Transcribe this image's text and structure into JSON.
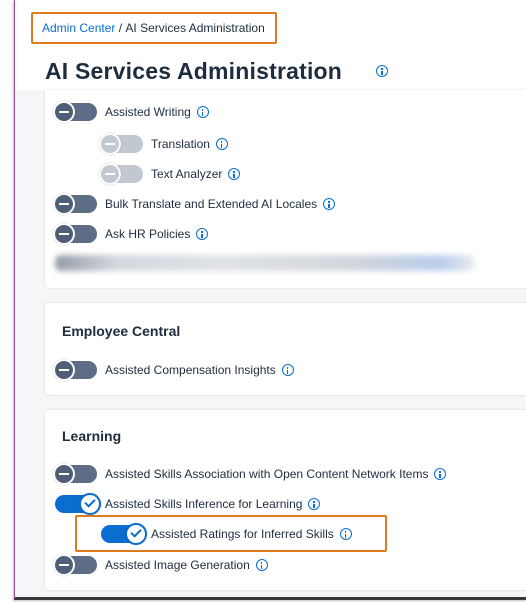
{
  "breadcrumb": {
    "link": "Admin Center",
    "separator": " / ",
    "current": "AI Services Administration"
  },
  "page": {
    "title": "AI Services Administration"
  },
  "sections": {
    "general": {
      "items": [
        {
          "label": "Assisted Writing",
          "state": "off"
        },
        {
          "label": "Translation",
          "state": "disabled"
        },
        {
          "label": "Text Analyzer",
          "state": "disabled"
        },
        {
          "label": "Bulk Translate and Extended AI Locales",
          "state": "off"
        },
        {
          "label": "Ask HR Policies",
          "state": "off"
        }
      ]
    },
    "employee_central": {
      "title": "Employee Central",
      "items": [
        {
          "label": "Assisted Compensation Insights",
          "state": "off"
        }
      ]
    },
    "learning": {
      "title": "Learning",
      "items": [
        {
          "label": "Assisted Skills Association with Open Content Network Items",
          "state": "off"
        },
        {
          "label": "Assisted Skills Inference for Learning",
          "state": "on"
        },
        {
          "label": "Assisted Ratings for Inferred Skills",
          "state": "on"
        },
        {
          "label": "Assisted Image Generation",
          "state": "off"
        }
      ]
    }
  },
  "colors": {
    "accent": "#0a6ed1",
    "highlight": "#e07a1f",
    "toggle_off": "#5d6d85"
  }
}
